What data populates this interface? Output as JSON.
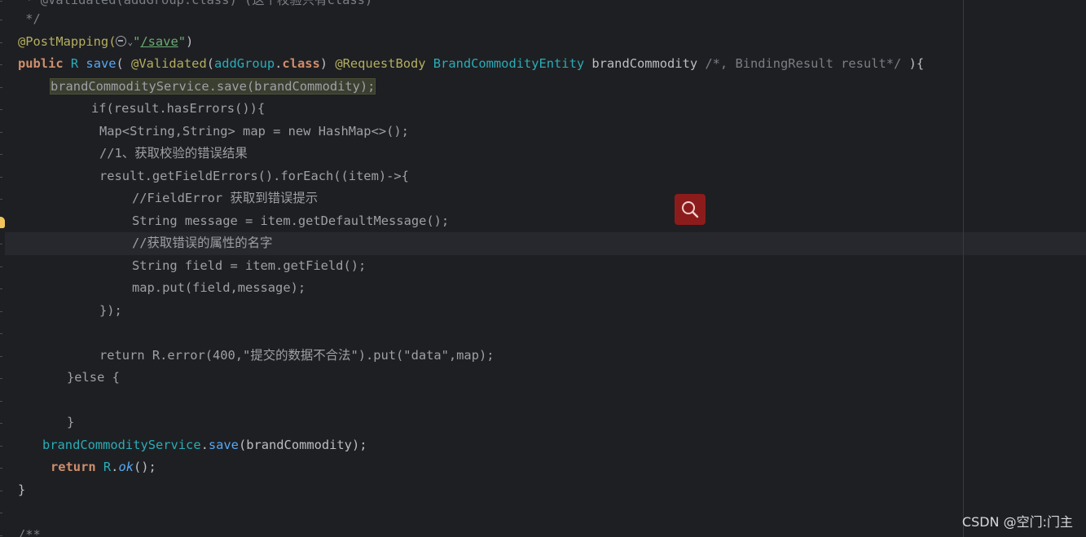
{
  "editor": {
    "lines": [
      {
        "id": "line-0",
        "segments": [
          {
            "cls": "c-comment",
            "text": " * @Validated(addGroup.class) (这个校验只有class)"
          }
        ]
      },
      {
        "id": "line-1",
        "segments": [
          {
            "cls": "c-comment",
            "text": " */"
          }
        ]
      },
      {
        "id": "line-2",
        "segments": [
          {
            "cls": "c-annot",
            "text": "@PostMapping("
          },
          {
            "cls": "icon"
          },
          {
            "cls": "c-string",
            "text": "\""
          },
          {
            "cls": "url",
            "text": "/save"
          },
          {
            "cls": "c-string",
            "text": "\""
          },
          {
            "cls": "c-plain",
            "text": ")"
          }
        ]
      },
      {
        "id": "line-3",
        "segments": [
          {
            "cls": "c-kw",
            "text": "public "
          },
          {
            "cls": "c-cls",
            "text": "R "
          },
          {
            "cls": "c-fn",
            "text": "save"
          },
          {
            "cls": "c-plain",
            "text": "( "
          },
          {
            "cls": "c-annot",
            "text": "@Validated"
          },
          {
            "cls": "c-plain",
            "text": "("
          },
          {
            "cls": "c-cls",
            "text": "addGroup"
          },
          {
            "cls": "c-plain",
            "text": "."
          },
          {
            "cls": "c-kw",
            "text": "class"
          },
          {
            "cls": "c-plain",
            "text": ") "
          },
          {
            "cls": "c-annot",
            "text": "@RequestBody "
          },
          {
            "cls": "c-cls",
            "text": "BrandCommodityEntity "
          },
          {
            "cls": "c-plain",
            "text": "brandCommodity "
          },
          {
            "cls": "c-comment",
            "text": "/*, BindingResult result*/ "
          },
          {
            "cls": "c-plain",
            "text": "){"
          }
        ]
      },
      {
        "id": "line-4",
        "segments": [
          {
            "cls": "c-disabled highlight",
            "text": "brandCommodityService.save(brandCommodity);"
          }
        ]
      },
      {
        "id": "line-5",
        "segments": [
          {
            "cls": "c-disabled",
            "text": "if(result.hasErrors()){"
          }
        ]
      },
      {
        "id": "line-6",
        "segments": [
          {
            "cls": "c-disabled",
            "text": "Map<String,String> map = new HashMap<>();"
          }
        ]
      },
      {
        "id": "line-7",
        "segments": [
          {
            "cls": "c-disabled",
            "text": "//1、获取校验的错误结果"
          }
        ]
      },
      {
        "id": "line-8",
        "segments": [
          {
            "cls": "c-disabled",
            "text": "result.getFieldErrors().forEach((item)->{"
          }
        ]
      },
      {
        "id": "line-9",
        "segments": [
          {
            "cls": "c-disabled",
            "text": "//FieldError 获取到错误提示"
          }
        ]
      },
      {
        "id": "line-10",
        "segments": [
          {
            "cls": "c-disabled",
            "text": "String message = item.getDefaultMessage();"
          }
        ]
      },
      {
        "id": "line-11",
        "segments": [
          {
            "cls": "c-disabled",
            "text": "//获取错误的属性的名字"
          }
        ]
      },
      {
        "id": "line-12",
        "segments": [
          {
            "cls": "c-disabled",
            "text": "String field = item.getField();"
          }
        ]
      },
      {
        "id": "line-13",
        "segments": [
          {
            "cls": "c-disabled",
            "text": "map.put(field,message);"
          }
        ]
      },
      {
        "id": "line-14",
        "segments": [
          {
            "cls": "c-disabled",
            "text": "});"
          }
        ]
      },
      {
        "id": "line-15",
        "segments": []
      },
      {
        "id": "line-16",
        "segments": [
          {
            "cls": "c-disabled",
            "text": "return R.error(400,\"提交的数据不合法\").put(\"data\",map);"
          }
        ]
      },
      {
        "id": "line-17",
        "segments": [
          {
            "cls": "c-disabled",
            "text": "}else {"
          }
        ]
      },
      {
        "id": "line-18",
        "segments": []
      },
      {
        "id": "line-19",
        "segments": [
          {
            "cls": "c-disabled",
            "text": "}"
          }
        ]
      },
      {
        "id": "line-20",
        "segments": [
          {
            "cls": "c-cls",
            "text": "brandCommodityService"
          },
          {
            "cls": "c-plain",
            "text": "."
          },
          {
            "cls": "c-method",
            "text": "save"
          },
          {
            "cls": "c-plain",
            "text": "(brandCommodity);"
          }
        ]
      },
      {
        "id": "line-21",
        "segments": [
          {
            "cls": "c-kw",
            "text": "return "
          },
          {
            "cls": "c-cls",
            "text": "R"
          },
          {
            "cls": "c-plain",
            "text": "."
          },
          {
            "cls": "c-method c-ital",
            "text": "ok"
          },
          {
            "cls": "c-plain",
            "text": "();"
          }
        ]
      },
      {
        "id": "line-22",
        "segments": [
          {
            "cls": "c-plain",
            "text": "}"
          }
        ]
      },
      {
        "id": "line-23",
        "segments": []
      },
      {
        "id": "line-24",
        "segments": [
          {
            "cls": "c-comment",
            "text": "/**"
          }
        ]
      }
    ]
  },
  "icons": {
    "web": "globe-icon",
    "chevron": "chevron-down-icon",
    "bulb": "lightbulb-icon",
    "search": "search-icon"
  },
  "colors": {
    "background": "#1e1f22",
    "keyword": "#cf8e6d",
    "annotation": "#b3ae60",
    "string": "#6aab73",
    "class": "#2aacb8",
    "method": "#56a8f5",
    "comment": "#7a7e85",
    "search_button": "#8c1c1c"
  },
  "watermark": "CSDN @空门:门主"
}
